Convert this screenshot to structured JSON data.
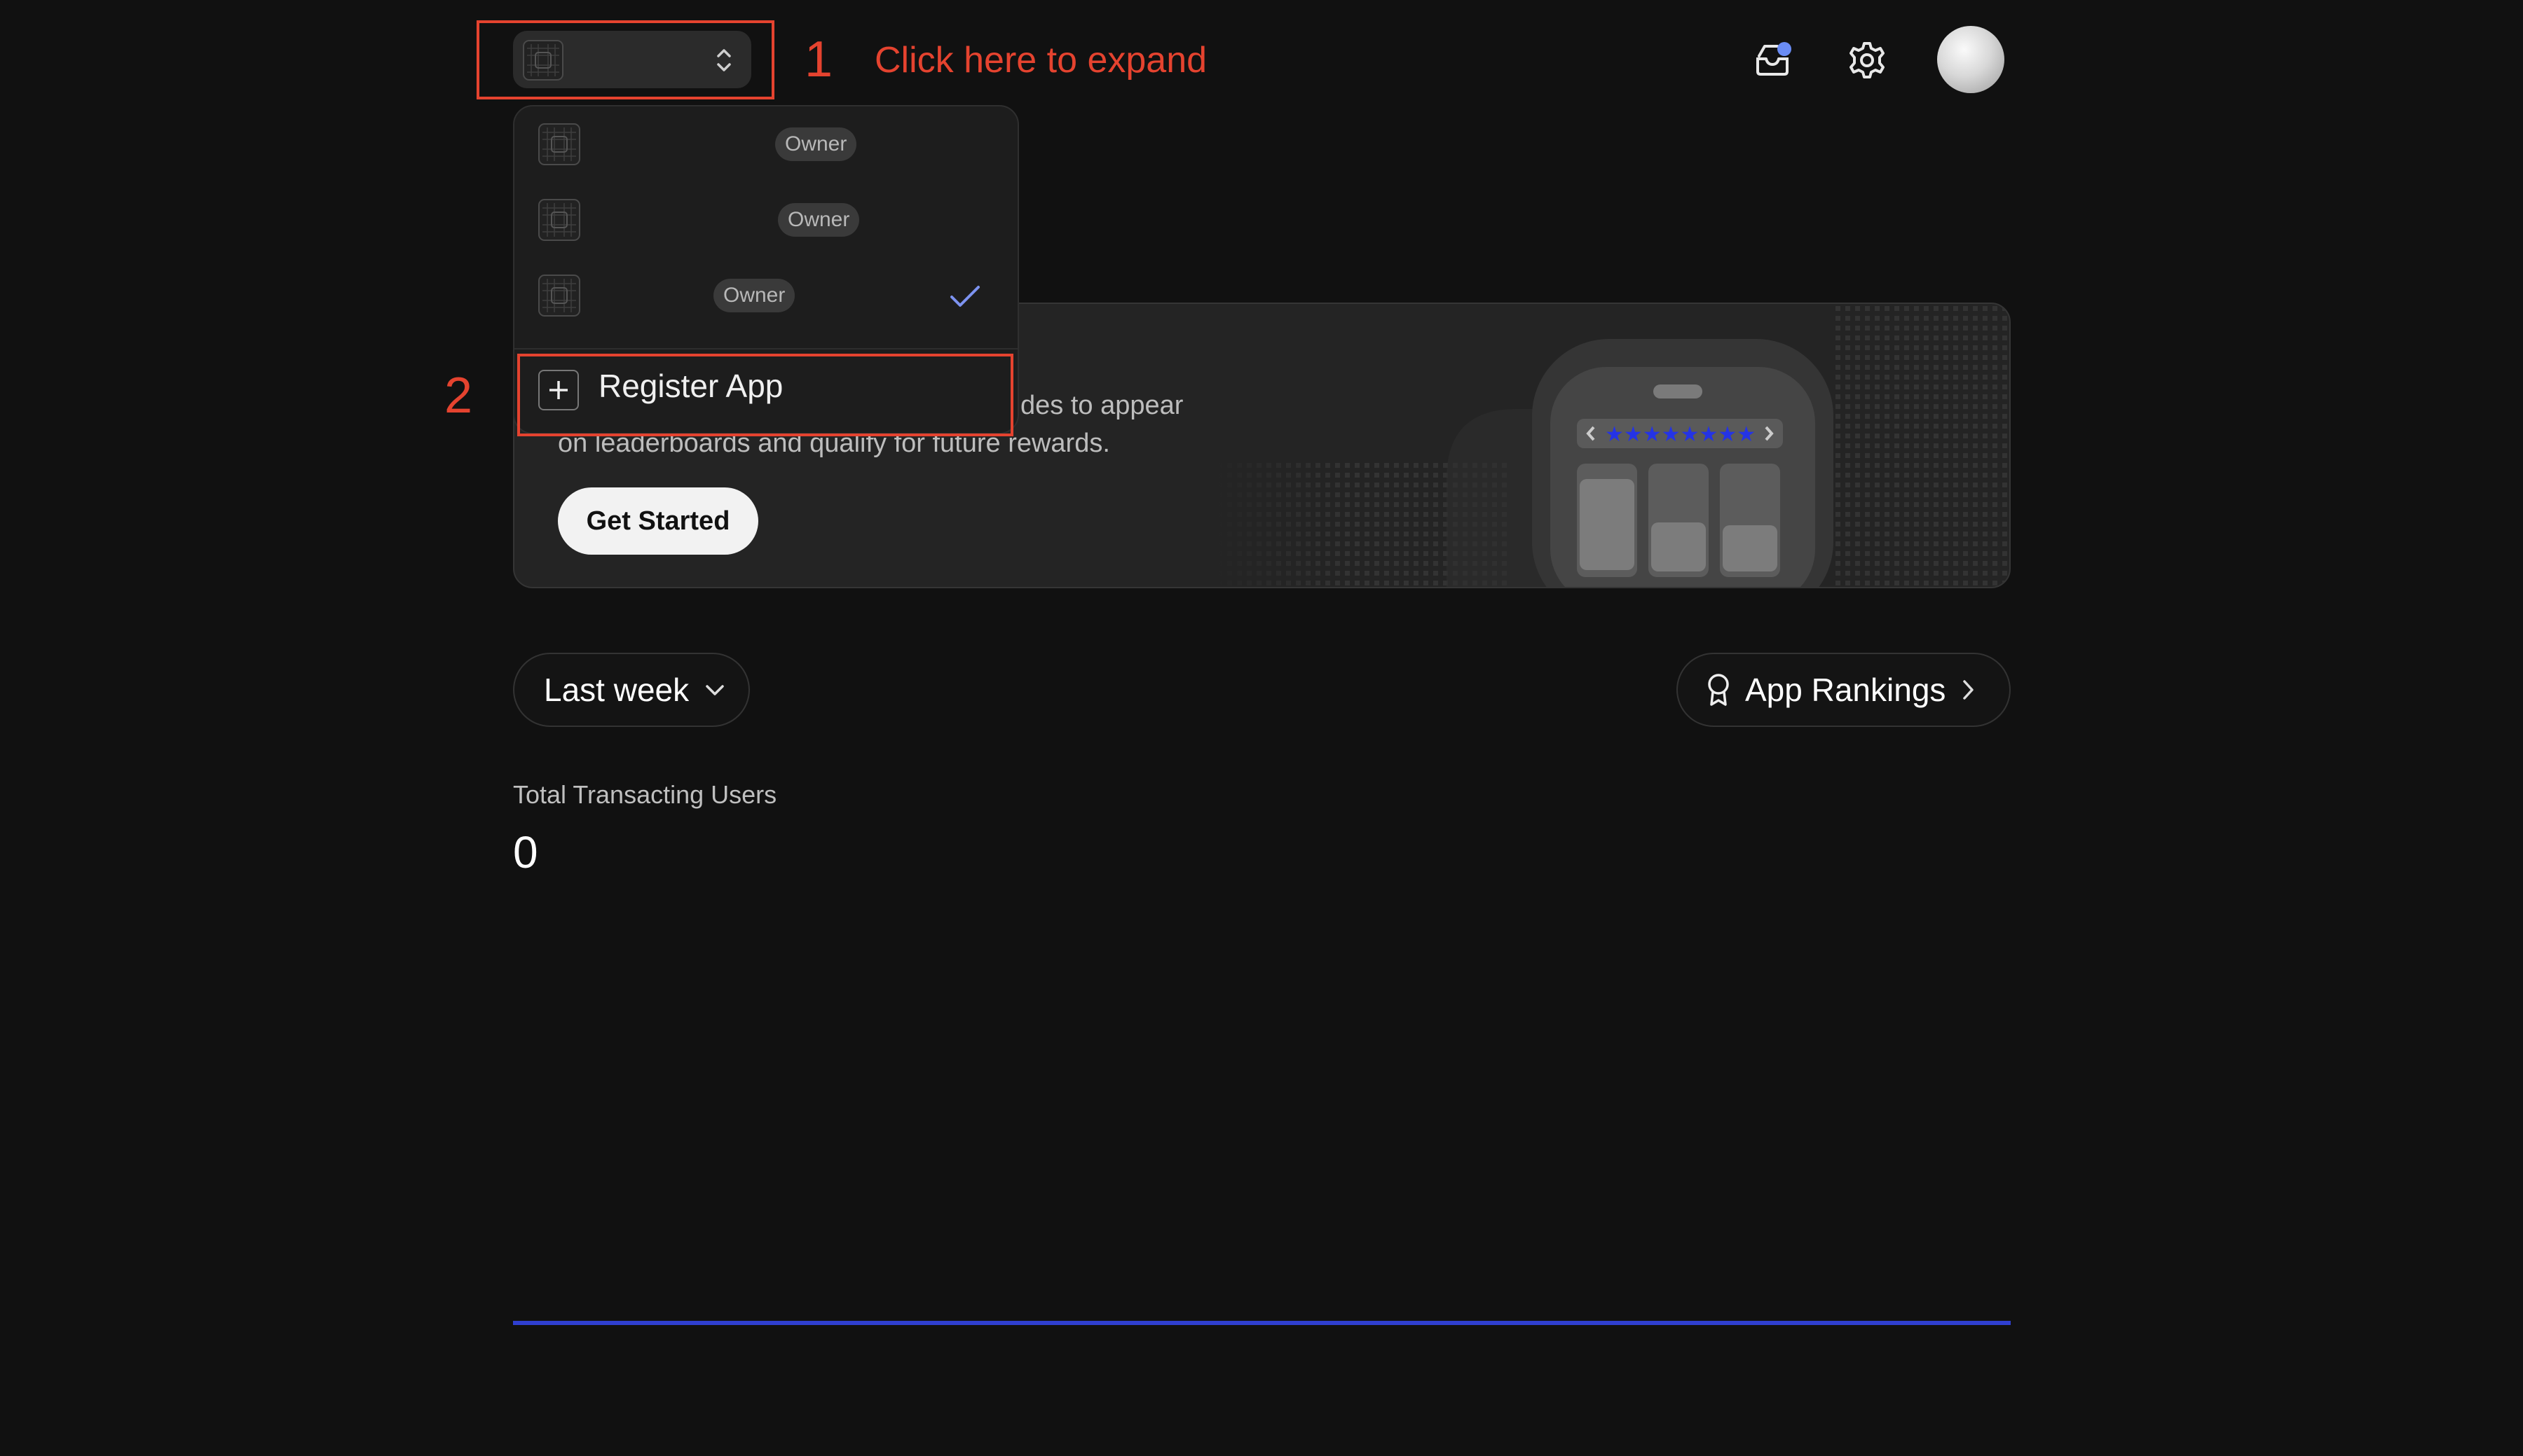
{
  "header": {
    "app_switcher_icon": "grid-app-icon",
    "expand_icon": "chevron-up-down-icon",
    "inbox_icon": "inbox-icon",
    "notification_dot_color": "#6a8cf5",
    "settings_icon": "gear-icon",
    "avatar": "user-avatar"
  },
  "annotations": {
    "step1_number": "1",
    "step1_text": "Click here to expand",
    "step2_number": "2",
    "color": "#e5432f"
  },
  "dropdown": {
    "apps": [
      {
        "role": "Owner",
        "selected": false
      },
      {
        "role": "Owner",
        "selected": false
      },
      {
        "role": "Owner",
        "selected": true
      }
    ],
    "register_label": "Register App",
    "check_color": "#7d93f0"
  },
  "banner": {
    "text_line1": "des to appear",
    "text_line2": "on leaderboards and qualify for future rewards.",
    "button_label": "Get Started"
  },
  "filters": {
    "period_label": "Last week",
    "rankings_label": "App Rankings"
  },
  "stats": {
    "total_label": "Total Transacting Users",
    "total_value": "0"
  },
  "chart": {
    "line_color": "#2f3fd0"
  }
}
